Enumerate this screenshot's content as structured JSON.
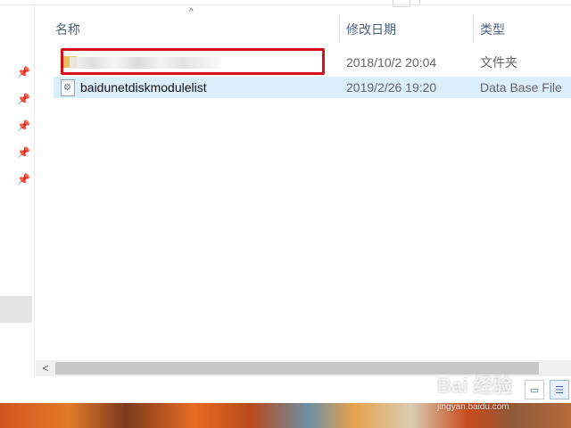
{
  "columns": {
    "name": "名称",
    "date_modified": "修改日期",
    "type": "类型"
  },
  "rows": [
    {
      "name": "",
      "date": "2018/10/2 20:04",
      "type": "文件夹"
    },
    {
      "name": "baidunetdiskmodulelist",
      "date": "2019/2/26 19:20",
      "type": "Data Base File"
    }
  ],
  "watermark": {
    "logo": "Bai 经验",
    "url": "jingyan.baidu.com"
  },
  "colors": {
    "selected_row": "#dbeefc",
    "highlight_box": "#d70f18",
    "header_text": "#4d6082"
  },
  "icons": {
    "pin": "pin-icon",
    "folder": "folder-icon",
    "file": "database-file-icon",
    "sort": "sort-up-icon"
  }
}
